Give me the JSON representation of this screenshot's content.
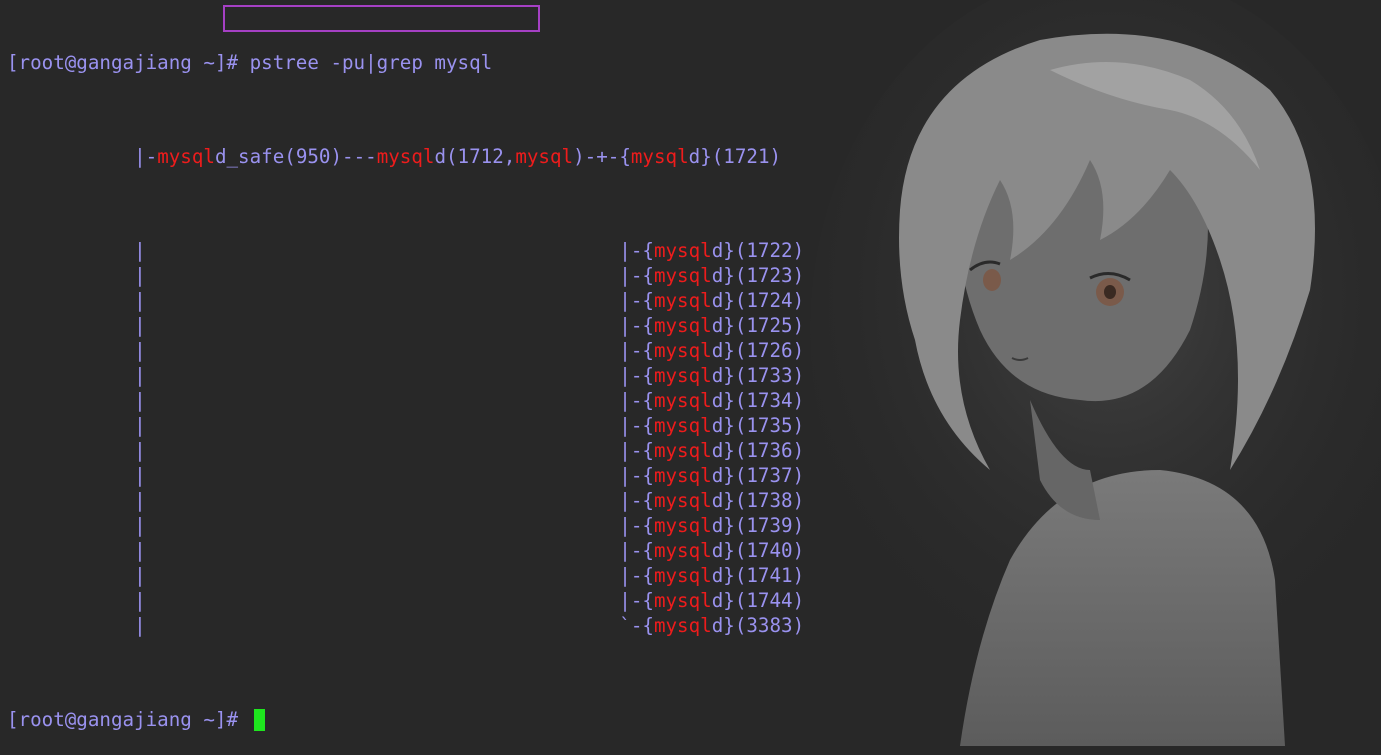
{
  "prompt": "[root@gangajiang ~]# ",
  "prompt_head": "[root@gangajiang ~",
  "command_rest": "]# pstree -pu|grep mysql",
  "tree_pad": "           ",
  "root_pipe": "|-",
  "match": "mysql",
  "first_row": {
    "safe_rest": "d_safe(950)---",
    "mysqld_rest": "d(1712,",
    "user_close": ")-+-"
  },
  "branch_mid": "|-",
  "branch_last": "`-",
  "col_pipe": "|",
  "child_open": "{",
  "child_rest": "d}",
  "threads": [
    "(1721)",
    "(1722)",
    "(1723)",
    "(1724)",
    "(1725)",
    "(1726)",
    "(1733)",
    "(1734)",
    "(1735)",
    "(1736)",
    "(1737)",
    "(1738)",
    "(1739)",
    "(1740)",
    "(1741)",
    "(1744)",
    "(3383)"
  ],
  "colors": {
    "background": "#282828",
    "text": "#9a92ef",
    "grep_match": "#ee1c1c",
    "cursor": "#1ee61e",
    "highlight_box": "#a540c4"
  }
}
